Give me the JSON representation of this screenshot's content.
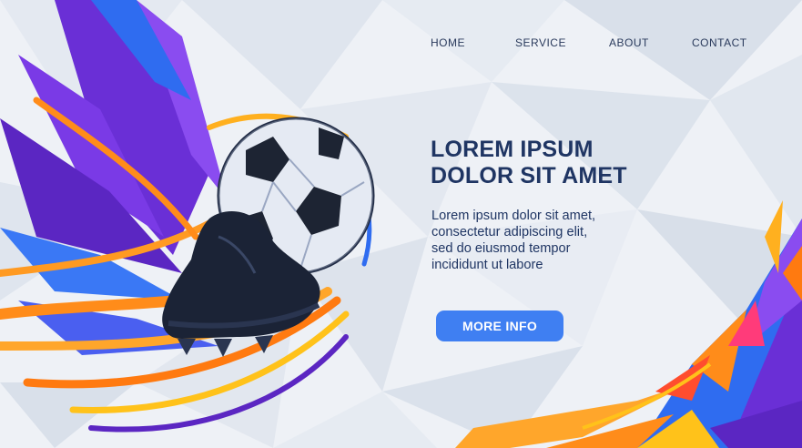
{
  "nav": {
    "items": [
      {
        "label": "HOME"
      },
      {
        "label": "SERVICE"
      },
      {
        "label": "ABOUT"
      },
      {
        "label": "CONTACT"
      }
    ]
  },
  "hero": {
    "title_lines": [
      "LOREM IPSUM",
      "DOLOR SIT AMET"
    ],
    "body_lines": [
      "Lorem ipsum dolor sit amet,",
      "consectetur adipiscing elit,",
      "sed do eiusmod tempor",
      "incididunt ut labore"
    ],
    "cta_label": "MORE INFO"
  },
  "colors": {
    "accent": "#3f7ff2",
    "heading": "#1f3563",
    "nav_text": "#2a3a5c",
    "purple": "#6a2fd6",
    "orange": "#ff8c1a",
    "yellow": "#ffc21a",
    "blue": "#2f6cf0",
    "background": "#eef1f6"
  },
  "illustration": {
    "subject": "soccer-ball-and-cleat-with-flames"
  }
}
